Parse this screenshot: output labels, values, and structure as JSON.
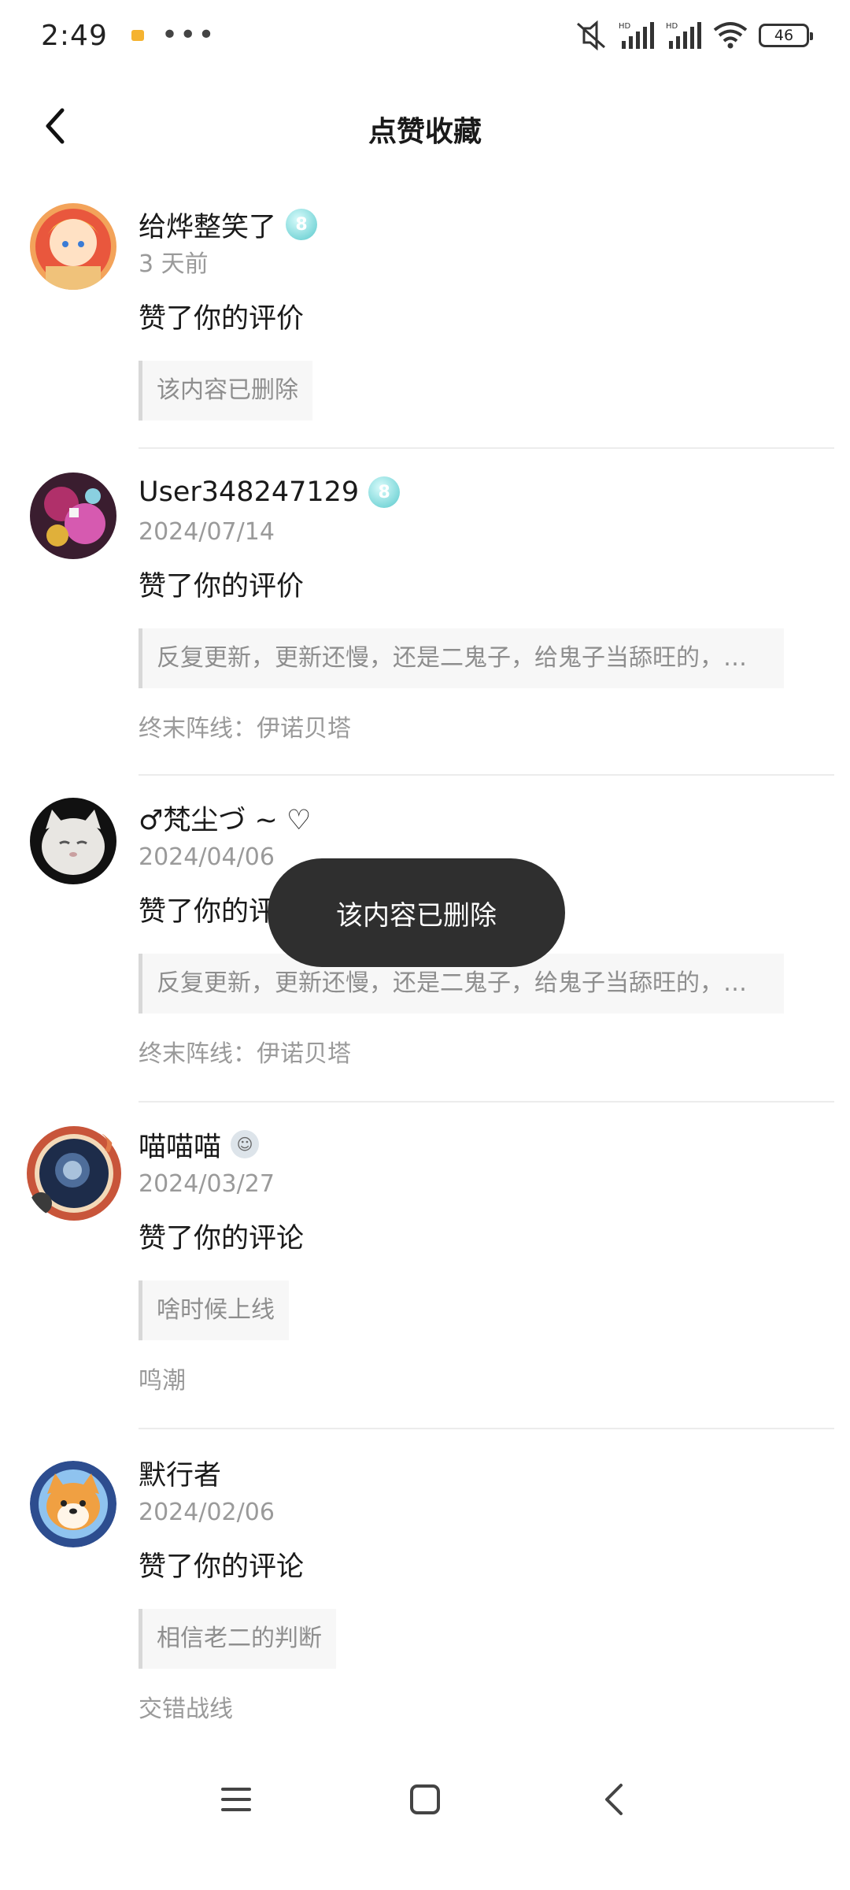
{
  "status_bar": {
    "time": "2:49",
    "more": "•••",
    "battery": "46"
  },
  "header": {
    "title": "点赞收藏"
  },
  "items": [
    {
      "name": "给烨整笑了",
      "badge": "8",
      "time": "3 天前",
      "action": "赞了你的评价",
      "quote": "该内容已删除",
      "game": ""
    },
    {
      "name": "User348247129",
      "badge": "8",
      "time": "2024/07/14",
      "action": "赞了你的评价",
      "quote": "反复更新，更新还慢，还是二鬼子，给鬼子当舔旺的，倒…",
      "game": "终末阵线：伊诺贝塔"
    },
    {
      "name": "♂梵尘づ ~ ♡",
      "badge": "",
      "time": "2024/04/06",
      "action": "赞了你的评价",
      "quote": "反复更新，更新还慢，还是二鬼子，给鬼子当舔旺的，倒…",
      "game": "终末阵线：伊诺贝塔"
    },
    {
      "name": "喵喵喵",
      "badge": "emoji",
      "time": "2024/03/27",
      "action": "赞了你的评论",
      "quote": "啥时候上线",
      "game": "鸣潮"
    },
    {
      "name": "默行者",
      "badge": "",
      "time": "2024/02/06",
      "action": "赞了你的评论",
      "quote": "相信老二的判断",
      "game": "交错战线"
    }
  ],
  "toast": {
    "text": "该内容已删除"
  },
  "colors": {
    "level_badge": "#7fd8da",
    "toast_bg": "#2f2f2f",
    "secondary_text": "#9a9a9a"
  }
}
